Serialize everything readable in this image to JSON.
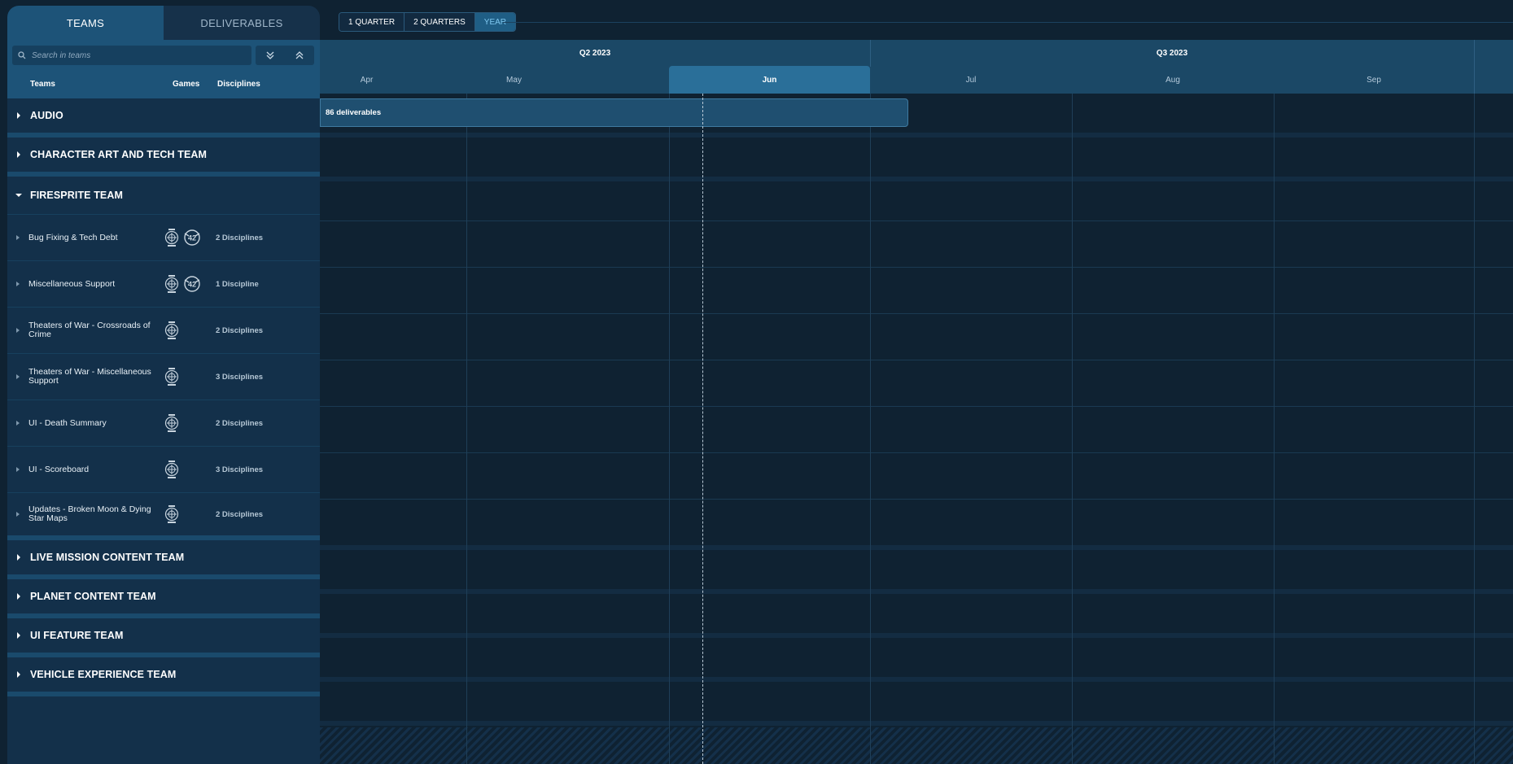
{
  "tabs": {
    "teams": "TEAMS",
    "deliverables": "DELIVERABLES"
  },
  "search": {
    "placeholder": "Search in teams"
  },
  "columns": {
    "teams": "Teams",
    "games": "Games",
    "disciplines": "Disciplines"
  },
  "zoom": {
    "quarter1": "1 QUARTER",
    "quarter2": "2 QUARTERS",
    "year": "YEAR",
    "selected": "YEAR"
  },
  "quarters": [
    "Q2 2023",
    "Q3 2023"
  ],
  "months": [
    "Apr",
    "May",
    "Jun",
    "Jul",
    "Aug",
    "Sep"
  ],
  "current_month": "Jun",
  "teams": [
    {
      "name": "AUDIO",
      "expanded": false,
      "deliverables": "86 deliverables"
    },
    {
      "name": "CHARACTER ART AND TECH TEAM",
      "expanded": false
    },
    {
      "name": "FIRESPRITE TEAM",
      "expanded": true,
      "items": [
        {
          "name": "Bug Fixing & Tech Debt",
          "games": [
            "star-citizen-logo-icon",
            "squadron-42-logo-icon"
          ],
          "disciplines": "2 Disciplines"
        },
        {
          "name": "Miscellaneous Support",
          "games": [
            "star-citizen-logo-icon",
            "squadron-42-logo-icon"
          ],
          "disciplines": "1 Discipline"
        },
        {
          "name": "Theaters of War - Crossroads of Crime",
          "games": [
            "star-citizen-logo-icon"
          ],
          "disciplines": "2 Disciplines"
        },
        {
          "name": "Theaters of War - Miscellaneous Support",
          "games": [
            "star-citizen-logo-icon"
          ],
          "disciplines": "3 Disciplines"
        },
        {
          "name": "UI - Death Summary",
          "games": [
            "star-citizen-logo-icon"
          ],
          "disciplines": "2 Disciplines"
        },
        {
          "name": "UI - Scoreboard",
          "games": [
            "star-citizen-logo-icon"
          ],
          "disciplines": "3 Disciplines"
        },
        {
          "name": "Updates - Broken Moon & Dying Star Maps",
          "games": [
            "star-citizen-logo-icon"
          ],
          "disciplines": "2 Disciplines"
        }
      ]
    },
    {
      "name": "LIVE MISSION CONTENT TEAM",
      "expanded": false
    },
    {
      "name": "PLANET CONTENT TEAM",
      "expanded": false
    },
    {
      "name": "UI FEATURE TEAM",
      "expanded": false
    },
    {
      "name": "VEHICLE EXPERIENCE TEAM",
      "expanded": false
    }
  ],
  "colors": {
    "accent": "#2a6f99",
    "panel": "#13304a",
    "background": "#0f2232",
    "selected_zoom_text": "#7fc8f0"
  }
}
